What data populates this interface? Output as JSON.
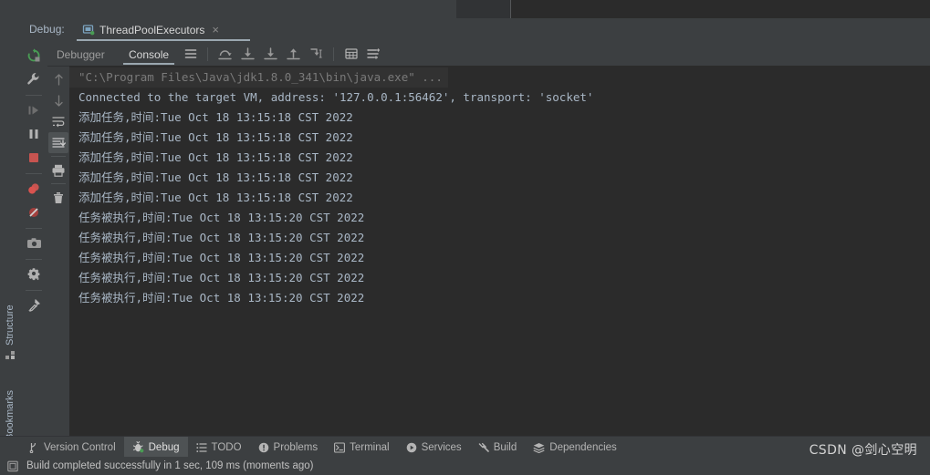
{
  "window": {
    "debug_label": "Debug:",
    "tab_title": "ThreadPoolExecutors",
    "tab_close": "×"
  },
  "subtabs": [
    {
      "label": "Debugger",
      "active": false
    },
    {
      "label": "Console",
      "active": true
    }
  ],
  "debug_toolbar": [
    {
      "name": "rerun-icon",
      "title": "Rerun"
    },
    {
      "name": "wrench-icon",
      "title": "Modify Run Configuration"
    },
    {
      "name": "resume-program-icon",
      "title": "Resume Program"
    },
    {
      "name": "pause-program-icon",
      "title": "Pause Program"
    },
    {
      "name": "stop-icon",
      "title": "Stop"
    },
    {
      "name": "view-breakpoints-icon",
      "title": "View Breakpoints"
    },
    {
      "name": "mute-breakpoints-icon",
      "title": "Mute Breakpoints"
    },
    {
      "name": "camera-icon",
      "title": "Take Screenshot"
    },
    {
      "name": "gear-icon",
      "title": "Settings"
    },
    {
      "name": "pin-icon",
      "title": "Pin Tab"
    }
  ],
  "step_toolbar": [
    {
      "name": "step-up-icon",
      "title": "Up the Stack"
    },
    {
      "name": "step-down-icon",
      "title": "Down the Stack"
    },
    {
      "name": "soft-wrap-icon",
      "title": "Use Soft Wraps"
    },
    {
      "name": "scroll-to-end-icon",
      "title": "Scroll to the End",
      "active": true
    },
    {
      "name": "print-icon",
      "title": "Print"
    },
    {
      "name": "trash-icon",
      "title": "Clear All"
    }
  ],
  "console_toolbar": [
    {
      "name": "show-execution-point-icon",
      "title": "Show Execution Point"
    },
    {
      "name": "step-over-icon",
      "title": "Step Over"
    },
    {
      "name": "step-into-icon",
      "title": "Step Into"
    },
    {
      "name": "force-step-into-icon",
      "title": "Force Step Into"
    },
    {
      "name": "step-out-icon",
      "title": "Step Out"
    },
    {
      "name": "run-to-cursor-icon",
      "title": "Run to Cursor"
    },
    {
      "name": "evaluate-expression-icon",
      "title": "Evaluate Expression"
    },
    {
      "name": "console-settings-icon",
      "title": "Settings"
    }
  ],
  "console": {
    "lines": [
      {
        "text": "\"C:\\Program Files\\Java\\jdk1.8.0_341\\bin\\java.exe\" ...",
        "type": "cmd"
      },
      {
        "text": "Connected to the target VM, address: '127.0.0.1:56462', transport: 'socket'",
        "type": "sysout"
      },
      {
        "text": "添加任务,时间:Tue Oct 18 13:15:18 CST 2022",
        "type": "sysout"
      },
      {
        "text": "添加任务,时间:Tue Oct 18 13:15:18 CST 2022",
        "type": "sysout"
      },
      {
        "text": "添加任务,时间:Tue Oct 18 13:15:18 CST 2022",
        "type": "sysout"
      },
      {
        "text": "添加任务,时间:Tue Oct 18 13:15:18 CST 2022",
        "type": "sysout"
      },
      {
        "text": "添加任务,时间:Tue Oct 18 13:15:18 CST 2022",
        "type": "sysout"
      },
      {
        "text": "任务被执行,时间:Tue Oct 18 13:15:20 CST 2022",
        "type": "sysout"
      },
      {
        "text": "任务被执行,时间:Tue Oct 18 13:15:20 CST 2022",
        "type": "sysout"
      },
      {
        "text": "任务被执行,时间:Tue Oct 18 13:15:20 CST 2022",
        "type": "sysout"
      },
      {
        "text": "任务被执行,时间:Tue Oct 18 13:15:20 CST 2022",
        "type": "sysout"
      },
      {
        "text": "任务被执行,时间:Tue Oct 18 13:15:20 CST 2022",
        "type": "sysout"
      }
    ]
  },
  "left_strip": {
    "structure_label": "Structure",
    "bookmarks_label": "Bookmarks"
  },
  "bottom_tools": [
    {
      "label": "Version Control",
      "icon": "branch-icon",
      "active": false
    },
    {
      "label": "Debug",
      "icon": "bug-icon",
      "active": true
    },
    {
      "label": "TODO",
      "icon": "list-icon",
      "active": false
    },
    {
      "label": "Problems",
      "icon": "warning-icon",
      "active": false
    },
    {
      "label": "Terminal",
      "icon": "terminal-icon",
      "active": false
    },
    {
      "label": "Services",
      "icon": "play-circle-icon",
      "active": false
    },
    {
      "label": "Build",
      "icon": "hammer-icon",
      "active": false
    },
    {
      "label": "Dependencies",
      "icon": "layers-icon",
      "active": false
    }
  ],
  "statusbar": {
    "message": "Build completed successfully in 1 sec, 109 ms (moments ago)",
    "icon": "build-status-icon"
  },
  "watermark": {
    "text": "CSDN @剑心空明"
  },
  "colors": {
    "panel_bg": "#3c3f41",
    "console_bg": "#2b2b2b",
    "editor_bg": "#2b2b2b",
    "text": "#a9b7c6",
    "accent_green": "#499c54",
    "accent_red": "#c75450",
    "active_tab_underline": "#9ba7b0"
  }
}
